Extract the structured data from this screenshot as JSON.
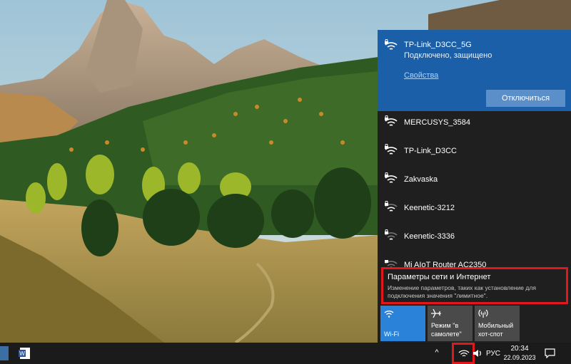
{
  "network_flyout": {
    "connected": {
      "ssid": "TP-Link_D3CC_5G",
      "status": "Подключено, защищено",
      "properties_label": "Свойства",
      "disconnect_label": "Отключиться",
      "icon": "wifi-secured-icon"
    },
    "networks": [
      {
        "ssid": "MERCUSYS_3584",
        "icon": "wifi-secured-icon"
      },
      {
        "ssid": "TP-Link_D3CC",
        "icon": "wifi-secured-icon"
      },
      {
        "ssid": "Zakvaska",
        "icon": "wifi-secured-icon"
      },
      {
        "ssid": "Keenetic-3212",
        "icon": "wifi-secured-icon"
      },
      {
        "ssid": "Keenetic-3336",
        "icon": "wifi-secured-icon"
      },
      {
        "ssid": "Mi AIoT Router AC2350",
        "icon": "wifi-secured-icon"
      }
    ],
    "settings_link": {
      "title": "Параметры сети и Интернет",
      "description": "Изменение параметров, таких как установление для подключения значения \"лимитное\"."
    },
    "quick_actions": {
      "wifi": {
        "label": "Wi-Fi",
        "icon": "wifi-icon"
      },
      "airplane": {
        "label": "Режим \"в самолете\"",
        "icon": "airplane-icon"
      },
      "hotspot": {
        "label": "Мобильный хот-спот",
        "icon": "hotspot-icon"
      }
    }
  },
  "taskbar": {
    "language": "РУС",
    "time": "20:34",
    "date": "22.09.2023"
  },
  "colors": {
    "flyout_bg": "#1f1f1f",
    "connected_bg": "#1a5fa8",
    "accent": "#2a83d8",
    "highlight_frame": "#e3161b"
  }
}
